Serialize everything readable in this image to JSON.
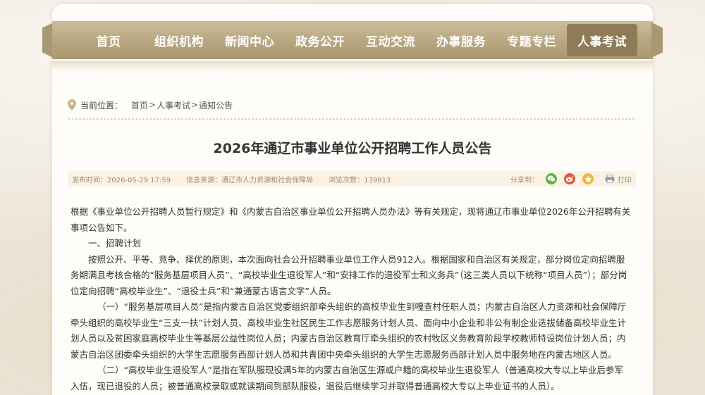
{
  "nav": {
    "items": [
      {
        "label": "首页"
      },
      {
        "label": "组织机构"
      },
      {
        "label": "新闻中心"
      },
      {
        "label": "政务公开"
      },
      {
        "label": "互动交流"
      },
      {
        "label": "办事服务"
      },
      {
        "label": "专题专栏"
      },
      {
        "label": "人事考试",
        "active": true
      }
    ]
  },
  "breadcrumb": {
    "label": "当前位置：",
    "items": [
      "首页",
      "人事考试",
      "通知公告"
    ],
    "separator": ">"
  },
  "article": {
    "title": "2026年通辽市事业单位公开招聘工作人员公告",
    "meta": {
      "publish_time": "发布时间：2026-05-29 17:59",
      "source": "信息来源：通辽市人力资源和社会保障局",
      "views": "浏览次数：139913"
    },
    "share": {
      "label": "分享到：",
      "icons": [
        "wechat-icon",
        "weibo-icon",
        "favorite-icon"
      ],
      "print_label": "打印"
    },
    "paragraphs": [
      "根据《事业单位公开招聘人员暂行规定》和《内蒙古自治区事业单位公开招聘人员办法》等有关规定，现将通辽市事业单位2026年公开招聘有关事项公告如下。",
      "一、招聘计划",
      "按照公开、平等、竞争、择优的原则，本次面向社会公开招聘事业单位工作人员912人。根据国家和自治区有关规定，部分岗位定向招聘服务期满且考核合格的“服务基层项目人员”、“高校毕业生退役军人”和“安排工作的退役军士和义务兵”（这三类人员以下统称“项目人员”）；部分岗位定向招聘“高校毕业生”、“退役士兵”和“兼通蒙古语言文字”人员。",
      "（一）“服务基层项目人员”是指内蒙古自治区党委组织部牵头组织的高校毕业生到嘎查村任职人员；内蒙古自治区人力资源和社会保障厅牵头组织的高校毕业生“三支一扶”计划人员、高校毕业生社区民生工作志愿服务计划人员、面向中小企业和非公有制企业选拔储备高校毕业生计划人员以及贫困家庭高校毕业生等基层公益性岗位人员；内蒙古自治区教育厅牵头组织的农村牧区义务教育阶段学校教师特设岗位计划人员；内蒙古自治区团委牵头组织的大学生志愿服务西部计划人员和共青团中央牵头组织的大学生志愿服务西部计划人员中服务地在内蒙古地区人员。",
      "（二）“高校毕业生退役军人”是指在军队服现役满5年的内蒙古自治区生源或户籍的高校毕业生退役军人（普通高校大专以上毕业后参军入伍，现已退役的人员；被普通高校录取或就读期间到部队服役，退役后继续学习并取得普通高校大专以上毕业证书的人员）。"
    ]
  },
  "colors": {
    "nav_bg": "#b8a67f",
    "nav_active": "#8e7c59",
    "meta_bg": "#faf3e5",
    "meta_text": "#a08a67"
  }
}
